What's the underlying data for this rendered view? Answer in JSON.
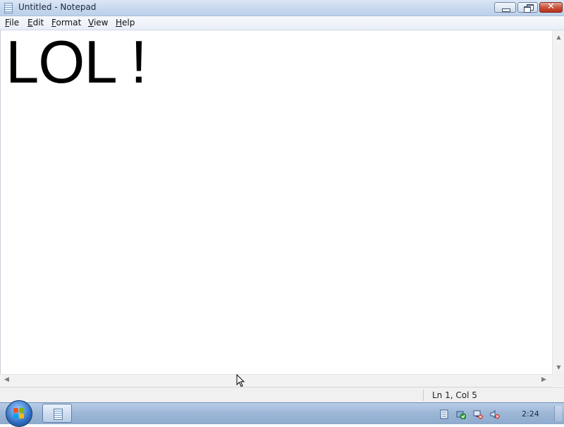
{
  "window": {
    "title": "Untitled - Notepad",
    "close_glyph": "✕"
  },
  "menu": {
    "items": [
      {
        "label_underlined": "F",
        "label_rest": "ile"
      },
      {
        "label_underlined": "E",
        "label_rest": "dit"
      },
      {
        "label_underlined": "F",
        "label_rest": "ormat"
      },
      {
        "label_underlined": "V",
        "label_rest": "iew"
      },
      {
        "label_underlined": "H",
        "label_rest": "elp"
      }
    ]
  },
  "editor": {
    "text": "LOL !"
  },
  "statusbar": {
    "position": "Ln 1, Col 5"
  },
  "taskbar": {
    "clock": "2:24",
    "tray_icons": [
      "notepad-tray-icon",
      "security-check-icon",
      "network-disconnected-icon",
      "volume-muted-icon"
    ]
  },
  "icons": {
    "scroll_up": "▲",
    "scroll_down": "▼",
    "scroll_left": "◀",
    "scroll_right": "▶"
  },
  "colors": {
    "titlebar": "#c7d8ee",
    "close_button": "#c9533d",
    "taskbar": "#9cb6d6",
    "editor_background": "#ffffff",
    "editor_text": "#000000"
  }
}
